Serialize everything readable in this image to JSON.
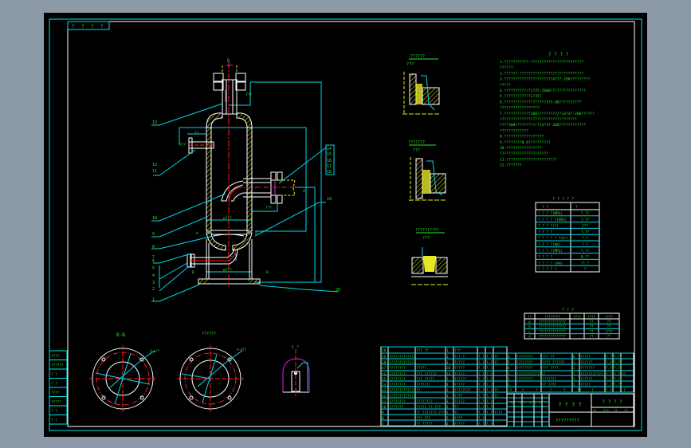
{
  "colors": {
    "canvas": "#000000",
    "border": "#00e5e5",
    "frame": "#ffffff",
    "text": "#27e827",
    "hatch": "#e8e820",
    "centerline": "#ff2020",
    "accent": "#e020e0",
    "dimension": "#00d8e8"
  },
  "corner_marks": [
    "?",
    "?",
    "?",
    "?"
  ],
  "main_view": {
    "top_label": "b",
    "dims": [
      "???",
      "??",
      "???",
      "ø???",
      "ø???",
      "???",
      "d",
      "a",
      "c",
      "A",
      "A",
      "B",
      "B"
    ],
    "callouts_left": [
      "13",
      "12",
      "11",
      "10",
      "9",
      "8",
      "7",
      "6",
      "5",
      "4",
      "3",
      "2",
      "1"
    ],
    "callouts_right": [
      "14",
      "15",
      "16",
      "17",
      "18",
      "19",
      "20"
    ]
  },
  "details": [
    {
      "title": "??????",
      "sub": "???"
    },
    {
      "title": "???????",
      "sub": "???"
    },
    {
      "title": "?????(???)",
      "sub": "???"
    }
  ],
  "section_views": {
    "bb_title": "B-B",
    "second_title": "??????",
    "c_title": "C  ?",
    "hole_note_1": "4-ø??",
    "hole_note_2": "4-ø??"
  },
  "notes": {
    "title": "? ? ? ?",
    "lines": [
      "1.???????????-????????????????????????",
      "  ??????",
      "2.??????-?????????????????????????????",
      "3.???????????????????/?14?3?-200?????????",
      "  ?????",
      "4.??????????/?1?25-2000????????????????",
      "5.????????????1?35?",
      "6.???????????????????3?5-80??????????",
      "  ??????????????????",
      "7.????????????100?????????/?14?3?-200??????",
      "  ???????????????????????????????????",
      "  ????300?????????/?14?3?-200????????????",
      "  ?????????????",
      "8.??????????????????",
      "9.????????0.8??????????",
      "10.????????????????",
      "  ??????????????????????",
      "11.???????????????????????",
      "12.???????"
    ]
  },
  "spec_table": {
    "title": "? ? ? ? ?",
    "header": [
      "? ?",
      "?"
    ],
    "rows": [
      [
        "? ? ? ?(MPa)",
        "?.??"
      ],
      [
        "? ? ? ? ?(MPa)",
        "?.??"
      ],
      [
        "? ? ? ?(?)",
        "1??"
      ],
      [
        "? ? ? ?",
        "?-??"
      ],
      [
        "? ? ? ? ? ?(m³)",
        "?.?"
      ],
      [
        "? ? ? ?(mm)",
        "?.?"
      ],
      [
        "? ? ? ?(MPa)",
        "?.??"
      ],
      [
        "? ? ? ?",
        "0.??"
      ],
      [
        "? ? ? ? (mm)",
        "??.?"
      ],
      [
        "? ? ? ? ?",
        "?"
      ]
    ]
  },
  "nozzle_table": {
    "title": "? ? ?",
    "header": [
      "??",
      "????????",
      "????",
      "????",
      "????"
    ],
    "rows": [
      [
        "a",
        "??????????????",
        "",
        "??",
        "??"
      ],
      [
        "b",
        "??????????????",
        "",
        "??",
        "??"
      ],
      [
        "c",
        "??????????????",
        "",
        "??",
        "????"
      ],
      [
        "d",
        "??????????????",
        "",
        "??",
        "??"
      ]
    ]
  },
  "parts_list_left": {
    "rows": [
      [
        "20",
        "",
        "??? ??",
        "1",
        "???",
        "",
        "",
        ""
      ],
      [
        "19",
        "?????????????",
        "",
        "1",
        "???-?",
        "?.?",
        "?.?",
        "??"
      ],
      [
        "18",
        "?????????????",
        "",
        "1",
        "?????",
        "?.?",
        "?.?",
        "??"
      ],
      [
        "17",
        "????????",
        "?????",
        "20",
        "?????",
        "?.?",
        "?.?",
        ""
      ],
      [
        "16",
        "????????",
        "??? ??????",
        "16",
        "?????",
        "?.?",
        "?.?",
        ""
      ],
      [
        "15",
        "????????",
        "??? ?????",
        "2",
        "??????",
        "?.?",
        "?.?",
        ""
      ],
      [
        "14",
        "????????",
        "???????",
        "4",
        "?????",
        "?.?",
        "?.?",
        ""
      ],
      [
        "13",
        "????????????",
        "??",
        "1",
        "????????",
        "?.?",
        "?.?",
        "??"
      ],
      [
        "12",
        "?????????????",
        "",
        "1",
        "????",
        "?.?",
        "?.?",
        "??"
      ],
      [
        "11",
        "????????",
        "????????",
        "1",
        "?????",
        "?.?",
        "?.?",
        ""
      ],
      [
        "10",
        "???????",
        "????? ??-???",
        "1",
        "??",
        "?.?",
        "?.?",
        ""
      ],
      [
        "9",
        "",
        "?? ???????-???",
        "1",
        "??",
        "?.?",
        "?.?",
        "????"
      ],
      [
        "8",
        "",
        "??? ???",
        "2",
        "????",
        "?.?",
        "",
        ""
      ],
      [
        "7",
        "",
        "?? ?????",
        "1",
        "?????",
        "?.?",
        "?.?",
        ""
      ]
    ]
  },
  "parts_list_right": {
    "rows": [
      [
        "6",
        "????????",
        "??? ??",
        "6",
        "?????",
        "?.??",
        "?.??",
        ""
      ],
      [
        "5",
        "????????",
        "???? ??????",
        "3",
        "??????",
        "?.??",
        "?.??",
        ""
      ],
      [
        "4",
        "????????",
        "??? ????",
        "1",
        "???????",
        "?.??",
        "?.??",
        ""
      ],
      [
        "3",
        "??????????????",
        "",
        "1",
        "???????????",
        "?.?",
        "?.?",
        "??"
      ],
      [
        "2",
        "????????",
        "???????",
        "1",
        "??????",
        "?.??",
        "?.??",
        ""
      ],
      [
        "1",
        "",
        "?? ????",
        "1",
        "?????",
        "?.?",
        "?.??",
        ""
      ]
    ],
    "header": [
      "??",
      "?",
      "?",
      "?",
      "?",
      "??",
      "?",
      "? ?",
      "? ?"
    ]
  },
  "title_block": {
    "drawing_name": "? ? ? ?",
    "company": "? ? ? ?",
    "drawing_no": "?????????",
    "cells": [
      "??",
      "???",
      "??",
      "??",
      "??",
      "? ?",
      "????",
      "??"
    ]
  },
  "side_table": [
    "????",
    "??????",
    "? ?",
    "? ?",
    "????",
    "?????",
    "? ?",
    "? ?"
  ]
}
